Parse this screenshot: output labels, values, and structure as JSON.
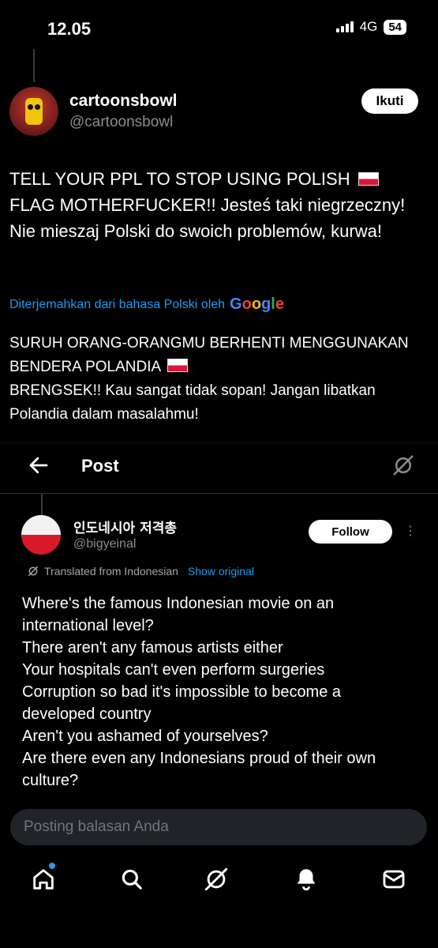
{
  "status": {
    "time": "12.05",
    "network": "4G",
    "battery": "54"
  },
  "tweet1": {
    "name": "cartoonsbowl",
    "handle": "@cartoonsbowl",
    "follow_label": "Ikuti",
    "text_part1": "TELL YOUR PPL TO STOP USING POLISH",
    "text_part2": "FLAG MOTHERFUCKER!! Jesteś taki niegrzeczny! Nie mieszaj Polski do swoich problemów, kurwa!",
    "translated_by": "Diterjemahkan dari bahasa Polski oleh",
    "translator_brand": "Google",
    "translation_part1": "SURUH ORANG-ORANGMU BERHENTI MENGGUNAKAN BENDERA POLANDIA",
    "translation_part2": "BRENGSEK!! Kau sangat tidak sopan! Jangan libatkan Polandia dalam masalahmu!"
  },
  "embedded": {
    "header_title": "Post",
    "name": "인도네시아 저격총",
    "handle": "@bigyeinal",
    "follow_label": "Follow",
    "more_label": "⋮",
    "translated_label": "Translated from Indonesian",
    "show_original_label": "Show original",
    "lines": [
      "Where's the famous Indonesian movie on an",
      "international level?",
      "There aren't any famous artists either",
      "Your hospitals can't even perform surgeries",
      "Corruption so bad it's impossible to become a",
      "developed country",
      "Aren't you ashamed of yourselves?",
      "Are there even any Indonesians proud of their own",
      "culture?"
    ]
  },
  "reply": {
    "placeholder": "Posting balasan Anda"
  },
  "nav": {
    "icons": [
      "home-icon",
      "search-icon",
      "grok-icon",
      "notifications-icon",
      "messages-icon"
    ]
  },
  "colors": {
    "accent": "#1d9bf0",
    "background": "#000000",
    "polish_red": "#dc143c"
  }
}
